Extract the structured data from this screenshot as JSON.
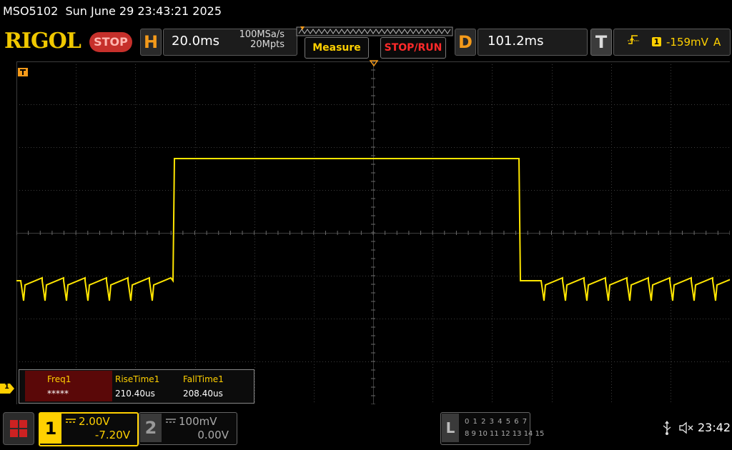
{
  "header": {
    "model": "MSO5102",
    "datetime": "Sun June 29 23:43:21 2025",
    "logo": "RIGOL",
    "run_state": "STOP"
  },
  "horizontal": {
    "letter": "H",
    "timebase": "20.0ms",
    "sample_rate": "100MSa/s",
    "memory_depth": "20Mpts"
  },
  "buttons": {
    "measure": "Measure",
    "stop_run": "STOP/RUN"
  },
  "delay": {
    "letter": "D",
    "value": "101.2ms"
  },
  "trigger": {
    "letter": "T",
    "edge_icon": "rising-edge-icon",
    "source": "1",
    "level": "-159mV",
    "mode": "A"
  },
  "markers": {
    "ch1_level": "1"
  },
  "measurements": [
    {
      "label": "Freq1",
      "value": "*****"
    },
    {
      "label": "RiseTime1",
      "value": "210.40us"
    },
    {
      "label": "FallTime1",
      "value": "208.40us"
    }
  ],
  "channels": [
    {
      "number": "1",
      "scale": "2.00V",
      "offset": "-7.20V",
      "active": true
    },
    {
      "number": "2",
      "scale": "100mV",
      "offset": "0.00V",
      "active": false
    }
  ],
  "logic": {
    "letter": "L",
    "row1": "0 1 2 3  4 5 6 7",
    "row2": "8 9 10 11 12 13 14 15"
  },
  "status": {
    "time": "23:42"
  },
  "colors": {
    "ch1": "#ffe600",
    "accent_orange": "#f49a1a",
    "stop_red": "#c6302b",
    "grid": "#3c3c3c",
    "background": "#000000"
  }
}
